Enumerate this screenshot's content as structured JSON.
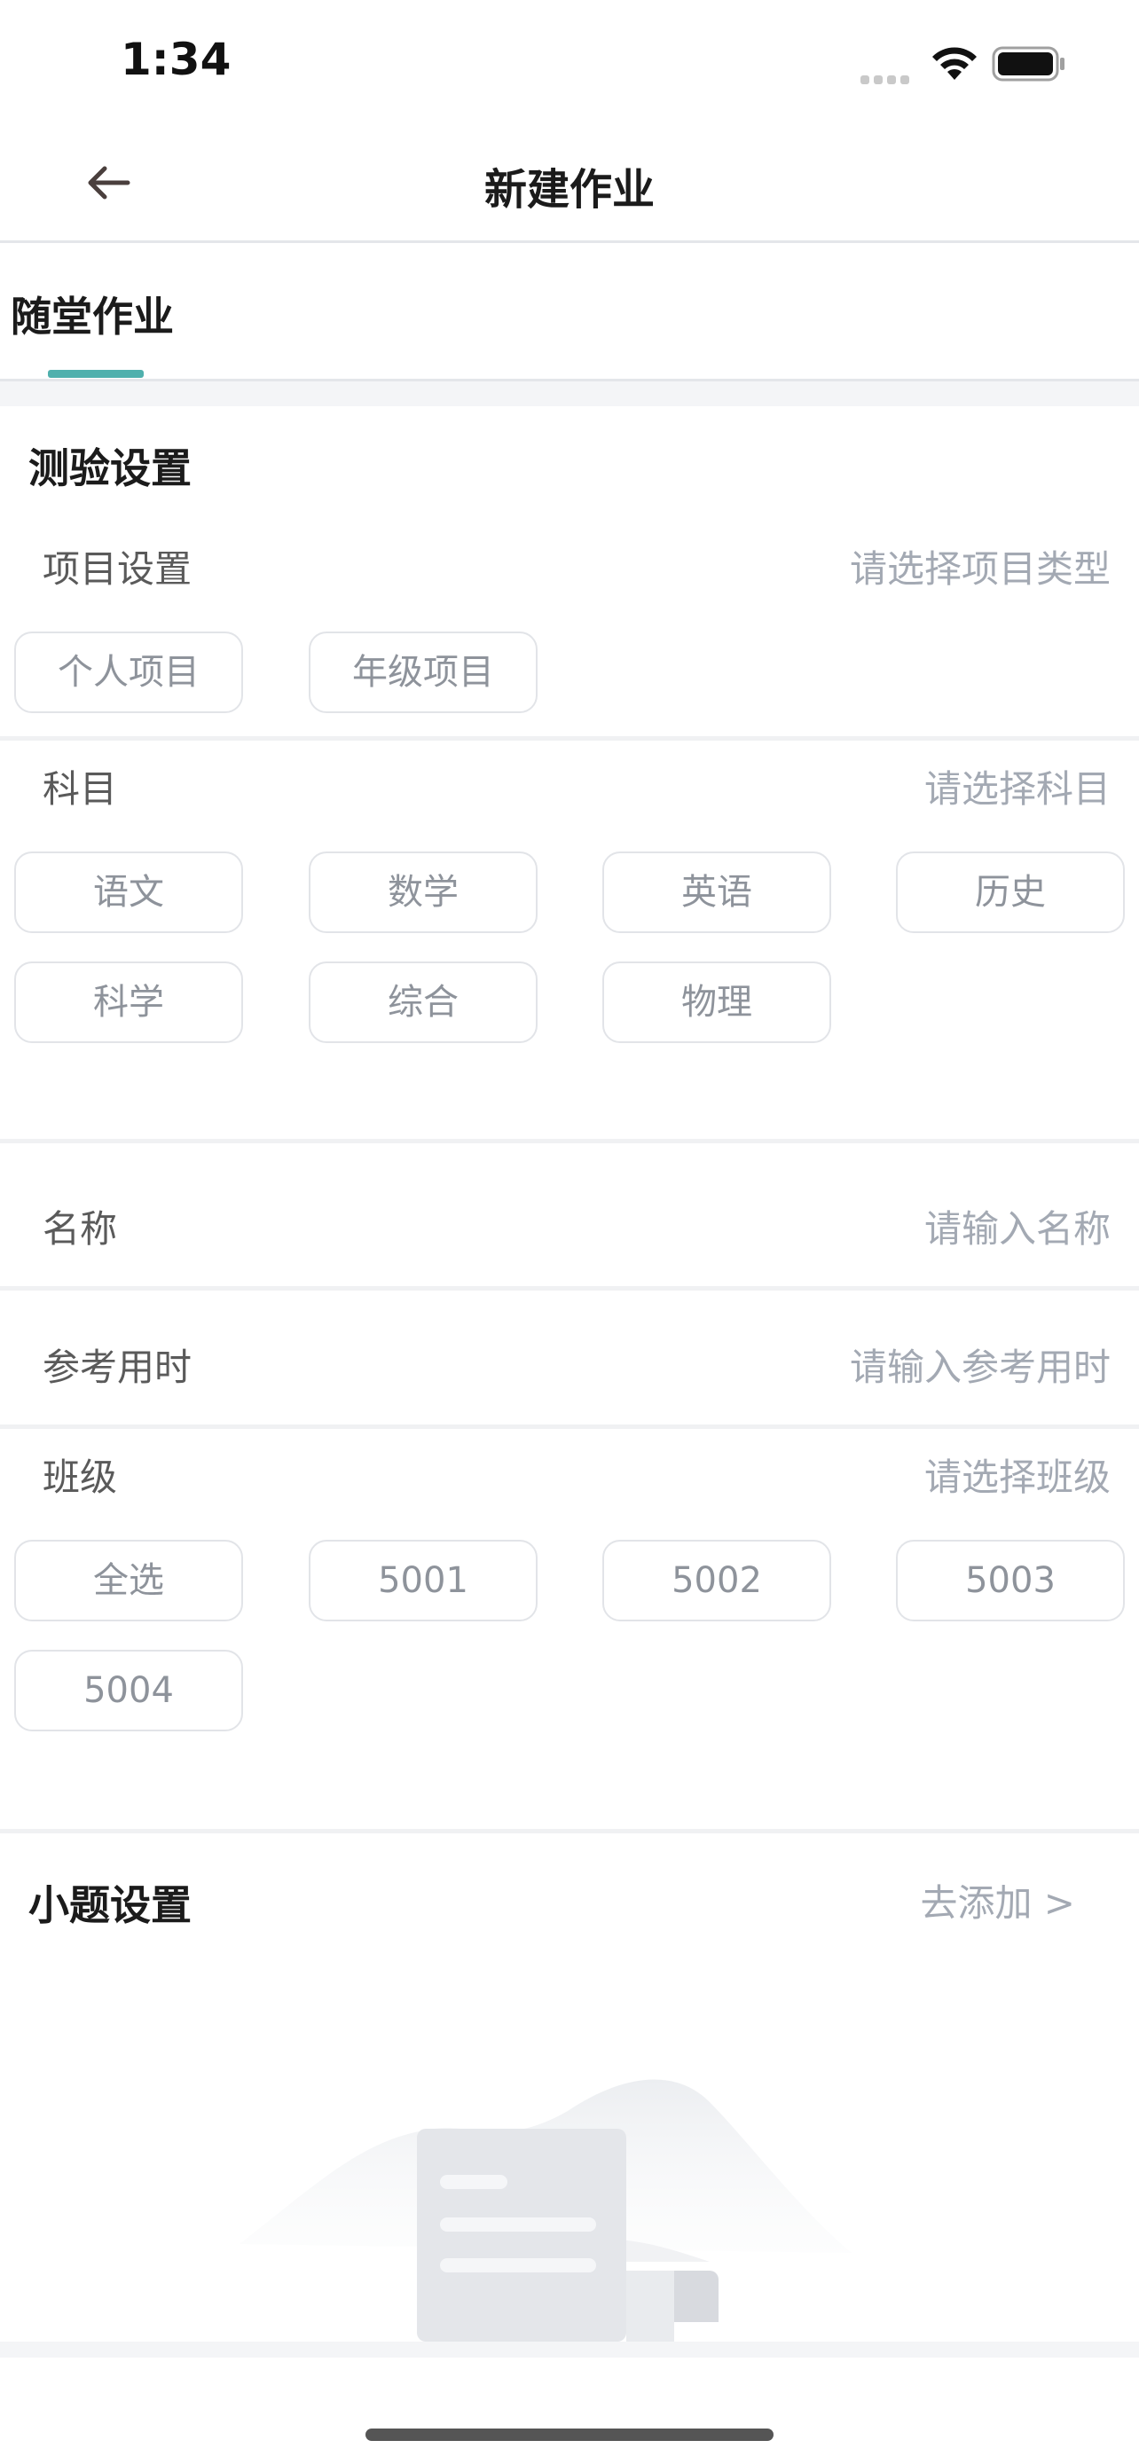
{
  "status_bar": {
    "time": "1:34",
    "signal_icon": "signal-icon",
    "wifi_icon": "wifi-icon",
    "battery_icon": "battery-icon"
  },
  "nav": {
    "back_icon": "arrow-left-icon",
    "title": "新建作业"
  },
  "tab": {
    "label": "随堂作业",
    "accent_color": "#4fb0ad"
  },
  "test_settings": {
    "title": "测验设置",
    "project": {
      "label": "项目设置",
      "hint": "请选择项目类型",
      "options": [
        "个人项目",
        "年级项目"
      ]
    },
    "subject": {
      "label": "科目",
      "hint": "请选择科目",
      "options": [
        "语文",
        "数学",
        "英语",
        "历史",
        "科学",
        "综合",
        "物理"
      ]
    },
    "name": {
      "label": "名称",
      "placeholder": "请输入名称"
    },
    "duration": {
      "label": "参考用时",
      "placeholder": "请输入参考用时"
    },
    "class": {
      "label": "班级",
      "hint": "请选择班级",
      "options": [
        "全选",
        "5001",
        "5002",
        "5003",
        "5004"
      ]
    }
  },
  "questions": {
    "title": "小题设置",
    "add_label": "去添加 >"
  }
}
